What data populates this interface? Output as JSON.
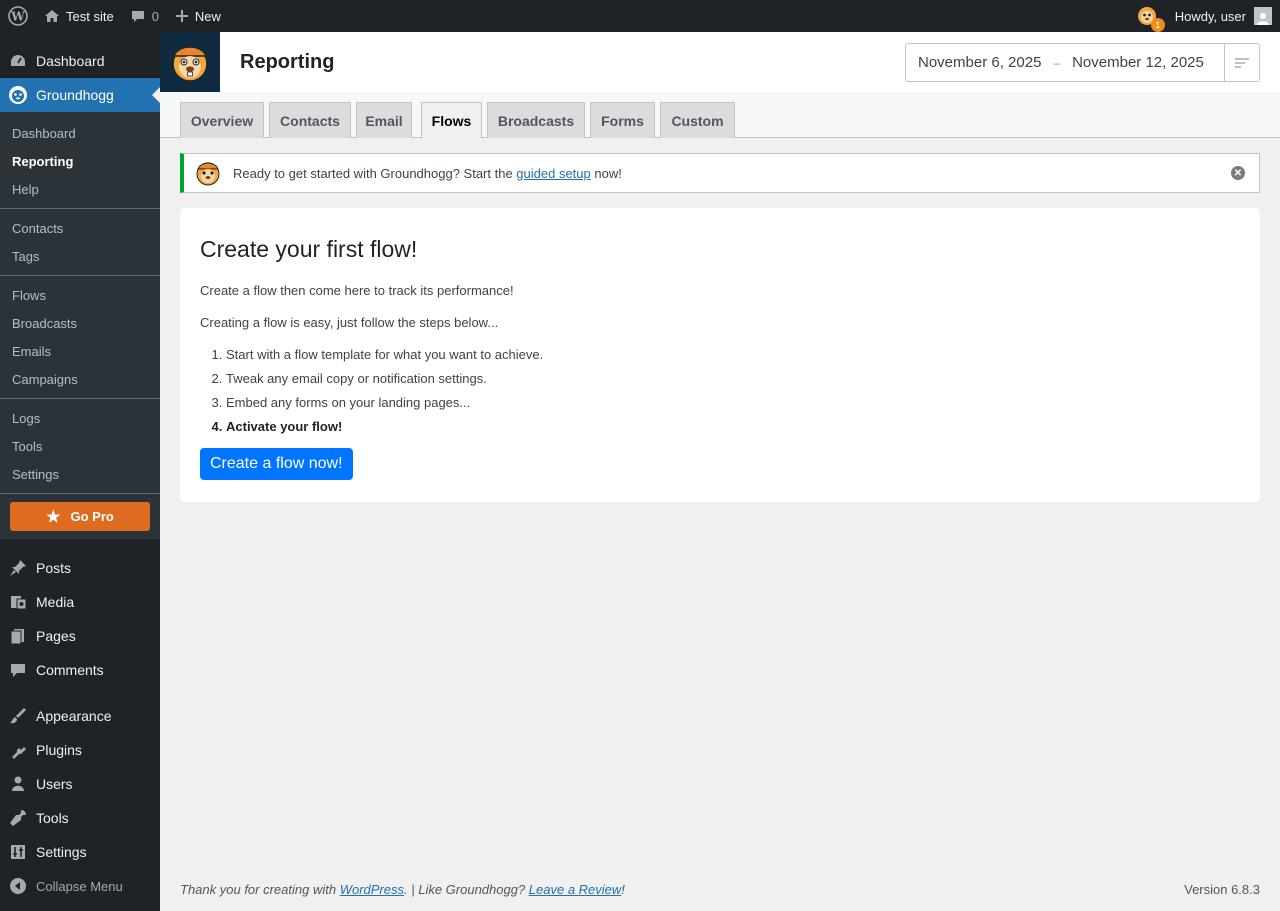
{
  "admin_bar": {
    "site_name": "Test site",
    "comments_count": "0",
    "new_label": "New",
    "notification_count": "1",
    "howdy": "Howdy, user"
  },
  "sidebar": {
    "dashboard": "Dashboard",
    "groundhogg": "Groundhogg",
    "sub_groups": [
      [
        "Dashboard",
        "Reporting",
        "Help"
      ],
      [
        "Contacts",
        "Tags"
      ],
      [
        "Flows",
        "Broadcasts",
        "Emails",
        "Campaigns"
      ],
      [
        "Logs",
        "Tools",
        "Settings"
      ]
    ],
    "go_pro": "Go Pro",
    "items": [
      {
        "label": "Posts",
        "icon": "pin-icon"
      },
      {
        "label": "Media",
        "icon": "media-icon"
      },
      {
        "label": "Pages",
        "icon": "pages-icon"
      },
      {
        "label": "Comments",
        "icon": "comments-icon"
      },
      {
        "label": "Appearance",
        "icon": "brush-icon"
      },
      {
        "label": "Plugins",
        "icon": "plugin-icon"
      },
      {
        "label": "Users",
        "icon": "users-icon"
      },
      {
        "label": "Tools",
        "icon": "wrench-icon"
      },
      {
        "label": "Settings",
        "icon": "sliders-icon"
      }
    ],
    "collapse": "Collapse Menu"
  },
  "header": {
    "title": "Reporting",
    "date_start": "November 6, 2025",
    "date_separator": "–",
    "date_end": "November 12, 2025"
  },
  "tabs": [
    "Overview",
    "Contacts",
    "Email",
    "Flows",
    "Broadcasts",
    "Forms",
    "Custom"
  ],
  "notice": {
    "before": "Ready to get started with Groundhogg? Start the ",
    "link": "guided setup",
    "after": " now!"
  },
  "card": {
    "title": "Create your first flow!",
    "p1": "Create a flow then come here to track its performance!",
    "p2": "Creating a flow is easy, just follow the steps below...",
    "steps": [
      "Start with a flow template for what you want to achieve.",
      "Tweak any email copy or notification settings.",
      "Embed any forms on your landing pages...",
      "Activate your flow!"
    ],
    "cta": "Create a flow now!"
  },
  "footer": {
    "thanks_before": "Thank you for creating with ",
    "wordpress_link": "WordPress",
    "thanks_middle": ". | Like Groundhogg? ",
    "review_link": "Leave a Review",
    "thanks_after": "!",
    "version": "Version 6.8.3"
  },
  "colors": {
    "admin_dark": "#1d2327",
    "accent_blue": "#2271b1",
    "go_pro_orange": "#dd6b20",
    "cta_blue": "#0075ff",
    "notice_green": "#00a32a"
  }
}
